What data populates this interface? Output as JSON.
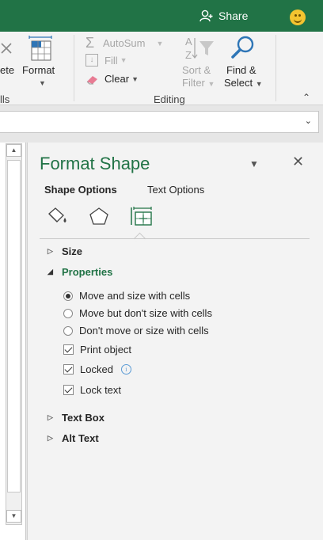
{
  "topbar": {
    "share_label": "Share"
  },
  "ribbon": {
    "delete_partial": "ete",
    "format_label": "Format",
    "cells_partial": "lls",
    "autosum_label": "AutoSum",
    "fill_label": "Fill",
    "clear_label": "Clear",
    "sort_line1": "Sort &",
    "sort_line2": "Filter",
    "find_line1": "Find &",
    "find_line2": "Select",
    "editing_label": "Editing"
  },
  "pane": {
    "title": "Format Shape",
    "tabs": [
      {
        "label": "Shape Options",
        "active": true
      },
      {
        "label": "Text Options",
        "active": false
      }
    ],
    "icons": [
      "fill-line-icon",
      "effects-icon",
      "size-properties-icon"
    ],
    "sections": {
      "size": "Size",
      "properties": "Properties",
      "text_box": "Text Box",
      "alt_text": "Alt Text"
    },
    "radios": [
      {
        "label": "Move and size with cells",
        "selected": true
      },
      {
        "label": "Move but don't size with cells",
        "selected": false
      },
      {
        "label": "Don't move or size with cells",
        "selected": false
      }
    ],
    "checks": [
      {
        "label": "Print object",
        "checked": true
      },
      {
        "label": "Locked",
        "checked": true
      },
      {
        "label": "Lock text",
        "checked": true
      }
    ]
  },
  "colors": {
    "accent": "#217346",
    "ribbon_bg": "#f3f3f3",
    "pane_bg": "#f3f3f3"
  }
}
